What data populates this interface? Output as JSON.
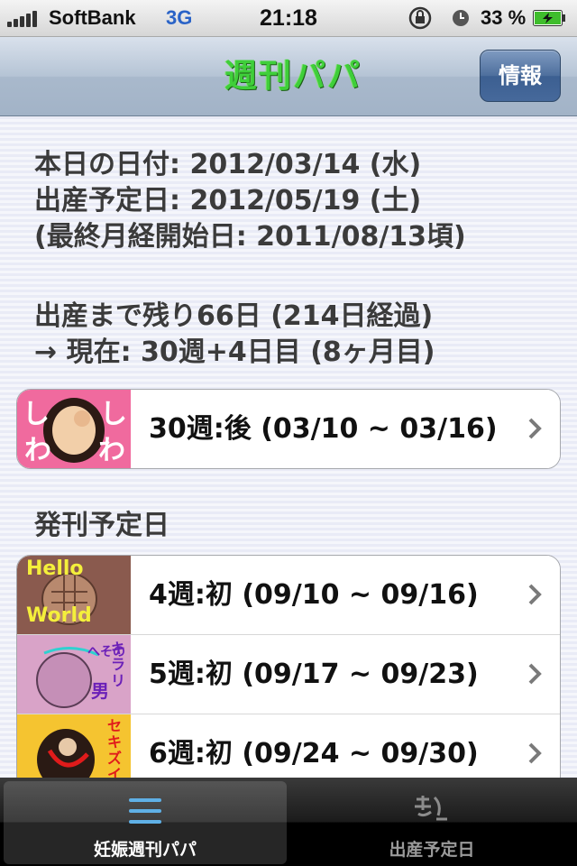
{
  "status_bar": {
    "carrier": "SoftBank",
    "network": "3G",
    "time": "21:18",
    "battery": "33 %"
  },
  "nav": {
    "title": "週刊パパ",
    "info_button": "情報"
  },
  "info": {
    "today": "本日の日付: 2012/03/14 (水)",
    "due_date": "出産予定日: 2012/05/19 (土)",
    "last_period": "(最終月経開始日: 2011/08/13頃)"
  },
  "countdown": {
    "remaining": "出産まで残り66日 (214日経過)",
    "current": "→ 現在: 30週+4日目 (8ヶ月目)"
  },
  "current_issue": {
    "label": "30週:後 (03/10 ~ 03/16)",
    "thumb_text": [
      "し",
      "わ",
      "し",
      "わ"
    ]
  },
  "schedule_header": "発刊予定日",
  "schedule": [
    {
      "label": "4週:初 (09/10 ~ 09/16)",
      "thumb_text": [
        "Hello",
        "World"
      ]
    },
    {
      "label": "5週:初 (09/17 ~ 09/23)",
      "thumb_text": [
        "へその",
        "男",
        "キラリ"
      ]
    },
    {
      "label": "6週:初 (09/24 ~ 09/30)",
      "thumb_text": [
        "セキズイ"
      ]
    }
  ],
  "tabs": [
    {
      "label": "妊娠週刊パパ",
      "icon": "list-icon",
      "active": true
    },
    {
      "label": "出産予定日",
      "icon": "calendar-icon",
      "active": false
    }
  ]
}
